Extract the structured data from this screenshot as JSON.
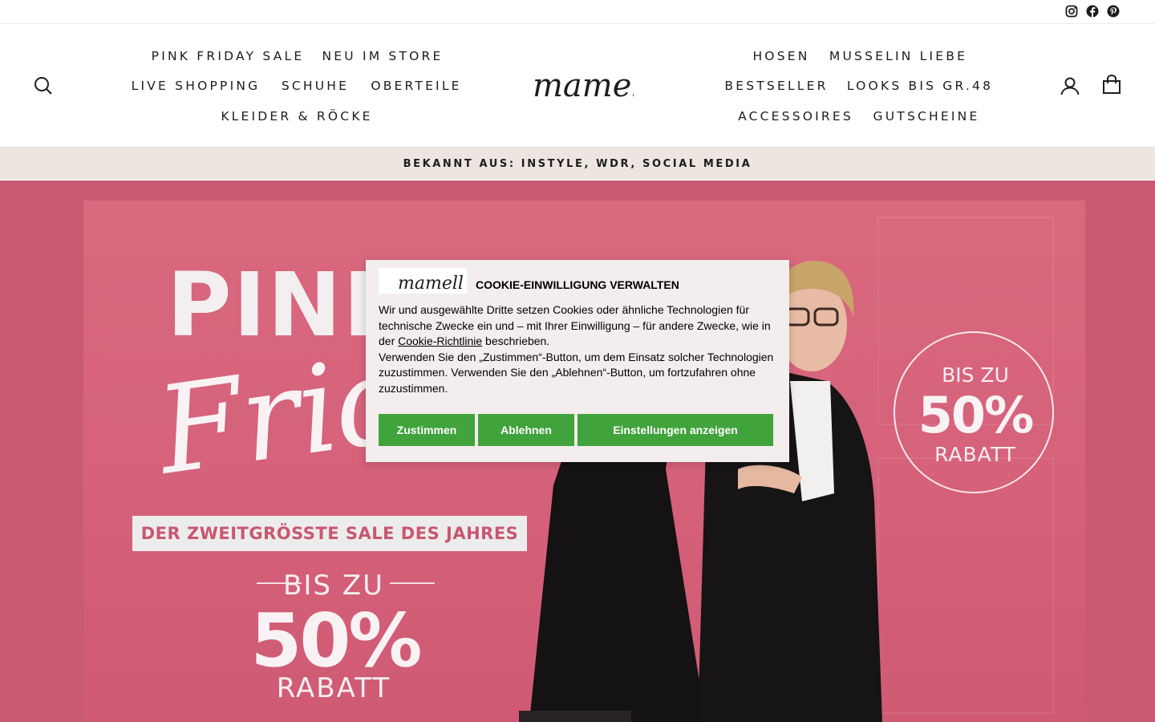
{
  "social": {
    "icons": [
      "instagram-icon",
      "facebook-icon",
      "pinterest-icon"
    ]
  },
  "nav": {
    "left_row1": [
      "PINK FRIDAY SALE",
      "NEU IM STORE"
    ],
    "left_row2": [
      "LIVE SHOPPING",
      "SCHUHE",
      "OBERTEILE"
    ],
    "left_row3": [
      "KLEIDER & RÖCKE"
    ],
    "right_row1": [
      "HOSEN",
      "MUSSELIN LIEBE"
    ],
    "right_row2": [
      "BESTSELLER",
      "LOOKS BIS GR.48"
    ],
    "right_row3": [
      "ACCESSOIRES",
      "GUTSCHEINE"
    ],
    "icons": [
      "search-icon",
      "account-icon",
      "cart-icon"
    ]
  },
  "logo": {
    "text": "mamell"
  },
  "announcement": {
    "text": "BEKANNT AUS: INSTYLE, WDR, SOCIAL MEDIA"
  },
  "hero": {
    "title_top": "PINK",
    "title_script": "Friday",
    "banner": "DER ZWEITGRÖSSTE SALE DES JAHRES",
    "bis_zu": "BIS ZU",
    "percent": "50%",
    "rabatt": "RABATT",
    "circle": {
      "line1": "BIS ZU",
      "line2": "50%",
      "line3": "RABATT"
    },
    "colors": {
      "background": "#c95a74",
      "panel": "#d5607a"
    }
  },
  "cookie": {
    "logo_text": "mamell",
    "title": "COOKIE-EINWILLIGUNG VERWALTEN",
    "text_part1": "Wir und ausgewählte Dritte setzen Cookies oder ähnliche Technologien für technische Zwecke ein und – mit Ihrer Einwilligung – für andere Zwecke, wie in der ",
    "link": "Cookie-Richtlinie",
    "text_part2": " beschrieben.",
    "text_para2": "Verwenden Sie den „Zustimmen“-Button, um dem Einsatz solcher Technologien zuzustimmen. Verwenden Sie den „Ablehnen“-Button, um fortzufahren ohne zuzustimmen.",
    "buttons": {
      "accept": "Zustimmen",
      "reject": "Ablehnen",
      "settings": "Einstellungen anzeigen"
    },
    "button_color": "#40a33b"
  }
}
